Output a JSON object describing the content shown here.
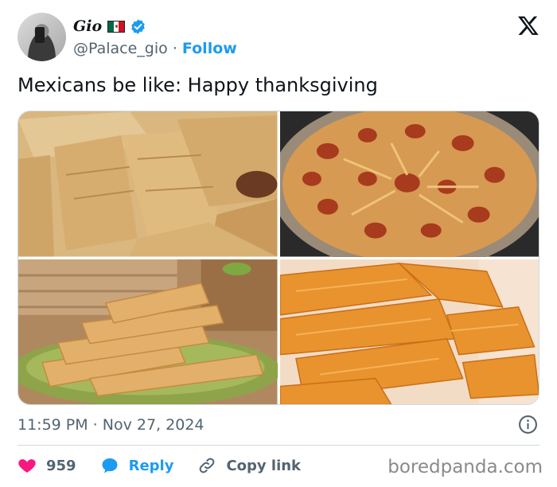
{
  "author": {
    "display_name": "Gio",
    "handle": "@Palace_gio",
    "separator": "·",
    "follow_label": "Follow",
    "flag": "mexico-flag-icon",
    "verified": "verified-badge-icon"
  },
  "tweet": {
    "text": "Mexicans be like: Happy thanksgiving",
    "timestamp": "11:59 PM · Nov 27, 2024"
  },
  "media": {
    "images": [
      {
        "subject": "tamales-in-husks"
      },
      {
        "subject": "red-tamales-in-pot"
      },
      {
        "subject": "tamales-on-green-plate"
      },
      {
        "subject": "orange-tamales-closeup"
      }
    ]
  },
  "actions": {
    "like_count": "959",
    "reply_label": "Reply",
    "copy_link_label": "Copy link"
  },
  "watermark": "boredpanda.com",
  "colors": {
    "accent": "#1d9bf0",
    "like": "#f91880",
    "secondary_text": "#536471",
    "border": "#cfd9de"
  }
}
